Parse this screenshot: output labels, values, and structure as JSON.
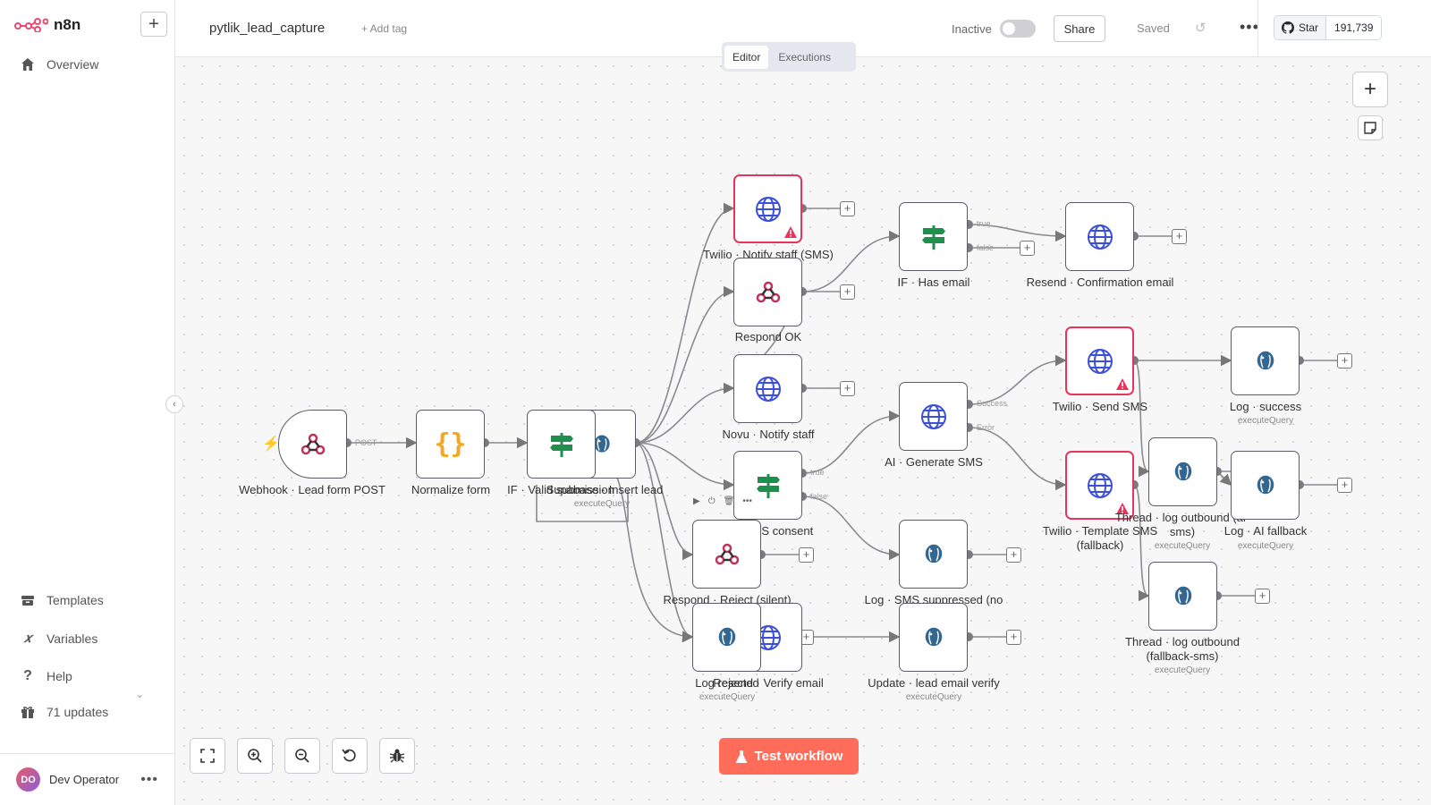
{
  "app": {
    "logo_text": "n8n",
    "workflow_name": "pytlik_lead_capture",
    "add_tag": "+ Add tag",
    "status_label": "Inactive",
    "share_label": "Share",
    "saved_label": "Saved",
    "github": {
      "star_label": "Star",
      "star_count": "191,739"
    }
  },
  "tabs": [
    {
      "label": "Editor",
      "active": true
    },
    {
      "label": "Executions",
      "active": false
    }
  ],
  "sidebar": {
    "items": [
      {
        "label": "Overview",
        "icon": "home-icon"
      },
      {
        "label": "Templates",
        "icon": "box-icon"
      },
      {
        "label": "Variables",
        "icon": "variable-icon"
      },
      {
        "label": "Help",
        "icon": "question-icon"
      },
      {
        "label": "71 updates",
        "icon": "gift-icon"
      }
    ],
    "user": {
      "initials": "DO",
      "name": "Dev Operator"
    }
  },
  "canvas": {
    "test_button": "Test workflow",
    "nodes": [
      {
        "label": "Webhook · Lead form POST",
        "icon": "webhook-icon"
      },
      {
        "label": "Normalize form",
        "icon": "code-braces-icon"
      },
      {
        "label": "IF · Valid submission",
        "icon": "if-signpost-icon"
      },
      {
        "label": "Supabase · Insert lead",
        "sub": "executeQuery",
        "icon": "postgres-icon"
      },
      {
        "label": "Twilio · Notify staff (SMS)",
        "icon": "http-globe-icon",
        "error": true
      },
      {
        "label": "Respond OK",
        "icon": "webhook-icon"
      },
      {
        "label": "Novu · Notify staff",
        "icon": "http-globe-icon"
      },
      {
        "label": "IF · SMS consent",
        "icon": "if-signpost-icon"
      },
      {
        "label": "Respond · Reject (silent)",
        "icon": "webhook-icon"
      },
      {
        "label": "Resend · Verify email",
        "icon": "http-globe-icon"
      },
      {
        "label": "Log rejected",
        "sub": "executeQuery",
        "icon": "postgres-icon"
      },
      {
        "label": "IF · Has email",
        "icon": "if-signpost-icon"
      },
      {
        "label": "AI · Generate SMS",
        "icon": "http-globe-icon"
      },
      {
        "label": "Log · SMS suppressed (no",
        "icon": "postgres-icon"
      },
      {
        "label": "Update · lead email verify",
        "sub": "executeQuery",
        "icon": "postgres-icon"
      },
      {
        "label": "Resend · Confirmation email",
        "icon": "http-globe-icon"
      },
      {
        "label": "Twilio · Send SMS",
        "icon": "http-globe-icon",
        "error": true
      },
      {
        "label": "Twilio · Template SMS (fallback)",
        "icon": "http-globe-icon",
        "error": true
      },
      {
        "label": "Thread · log outbound (ai-sms)",
        "sub": "executeQuery",
        "icon": "postgres-icon"
      },
      {
        "label": "Thread · log outbound (fallback-sms)",
        "sub": "executeQuery",
        "icon": "postgres-icon"
      },
      {
        "label": "Log · success",
        "sub": "executeQuery",
        "icon": "postgres-icon"
      },
      {
        "label": "Log · AI fallback",
        "sub": "executeQuery",
        "icon": "postgres-icon"
      }
    ],
    "edge_labels": {
      "post": "POST",
      "true": "true",
      "false": "false",
      "success": "Success",
      "error": "Error"
    }
  },
  "colors": {
    "accent": "#ff6d5a",
    "error_border": "#e8345a",
    "if_green": "#1f8f4e",
    "globe_blue": "#3b4fd8",
    "code_orange": "#f5a623",
    "postgres_blue": "#336791"
  }
}
